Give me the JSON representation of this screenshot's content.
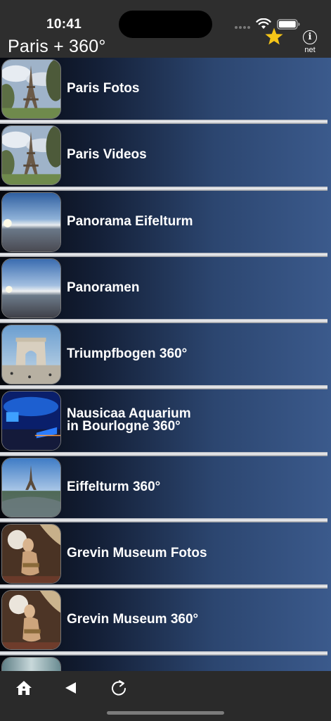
{
  "status_bar": {
    "time": "10:41"
  },
  "header": {
    "title": "Paris + 360°",
    "favorites_icon": "star-icon",
    "star_color": "#f5c518",
    "info_icon": "info-circle-icon",
    "info_label": "net"
  },
  "list": {
    "items": [
      {
        "label": "Paris Fotos",
        "thumb": "eiffel-tower-photo"
      },
      {
        "label": "Paris Videos",
        "thumb": "eiffel-tower-photo"
      },
      {
        "label": "Panorama Eifelturm",
        "thumb": "sky-panorama"
      },
      {
        "label": "Panoramen",
        "thumb": "sky-panorama"
      },
      {
        "label": "Triumpfbogen 360°",
        "thumb": "arc-de-triomphe"
      },
      {
        "label": "Nausicaa Aquarium\nin Bourlogne 360°",
        "thumb": "aquarium"
      },
      {
        "label": "Eiffelturm 360°",
        "thumb": "eiffel-tower-fisheye"
      },
      {
        "label": "Grevin Museum Fotos",
        "thumb": "wax-figure"
      },
      {
        "label": "Grevin Museum 360°",
        "thumb": "wax-figure"
      },
      {
        "label": "",
        "thumb": "partial-item"
      }
    ]
  },
  "toolbar": {
    "home_icon": "home-icon",
    "back_icon": "back-triangle-icon",
    "reload_icon": "reload-icon"
  }
}
